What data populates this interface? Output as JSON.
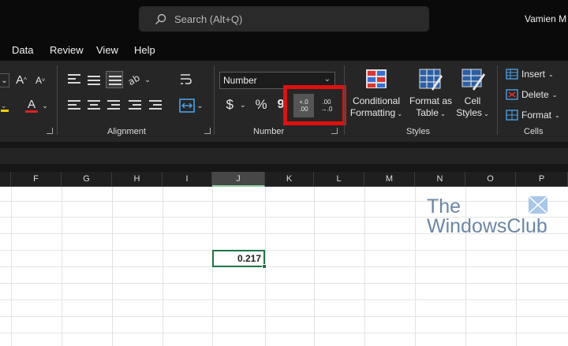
{
  "titlebar": {
    "search_placeholder": "Search (Alt+Q)",
    "user_name": "Vamien M"
  },
  "menu": {
    "items": [
      "Data",
      "Review",
      "View",
      "Help"
    ]
  },
  "ribbon": {
    "font_group": {
      "grow_font": "A",
      "shrink_font": "A",
      "font_color": "A"
    },
    "alignment_group": {
      "label": "Alignment"
    },
    "number_group": {
      "label": "Number",
      "format_value": "Number",
      "currency_symbol": "$",
      "percent_symbol": "%",
      "comma_symbol": "9",
      "increase_decimal_top": "+.0",
      "increase_decimal_bottom": ".00",
      "decrease_decimal_top": ".00",
      "decrease_decimal_bottom": "→.0"
    },
    "styles_group": {
      "label": "Styles",
      "conditional_formatting": [
        "Conditional",
        "Formatting"
      ],
      "format_as_table": [
        "Format as",
        "Table"
      ],
      "cell_styles": [
        "Cell",
        "Styles"
      ]
    },
    "cells_group": {
      "label": "Cells",
      "insert": "Insert",
      "delete": "Delete",
      "format": "Format"
    },
    "highlight_color": "#e01010"
  },
  "grid": {
    "columns": [
      "F",
      "G",
      "H",
      "I",
      "J",
      "K",
      "L",
      "M",
      "N",
      "O",
      "P"
    ],
    "selected_column": "J",
    "active_cell_value": "0.217"
  },
  "watermark": {
    "line1": "The",
    "line2": "WindowsClub"
  }
}
